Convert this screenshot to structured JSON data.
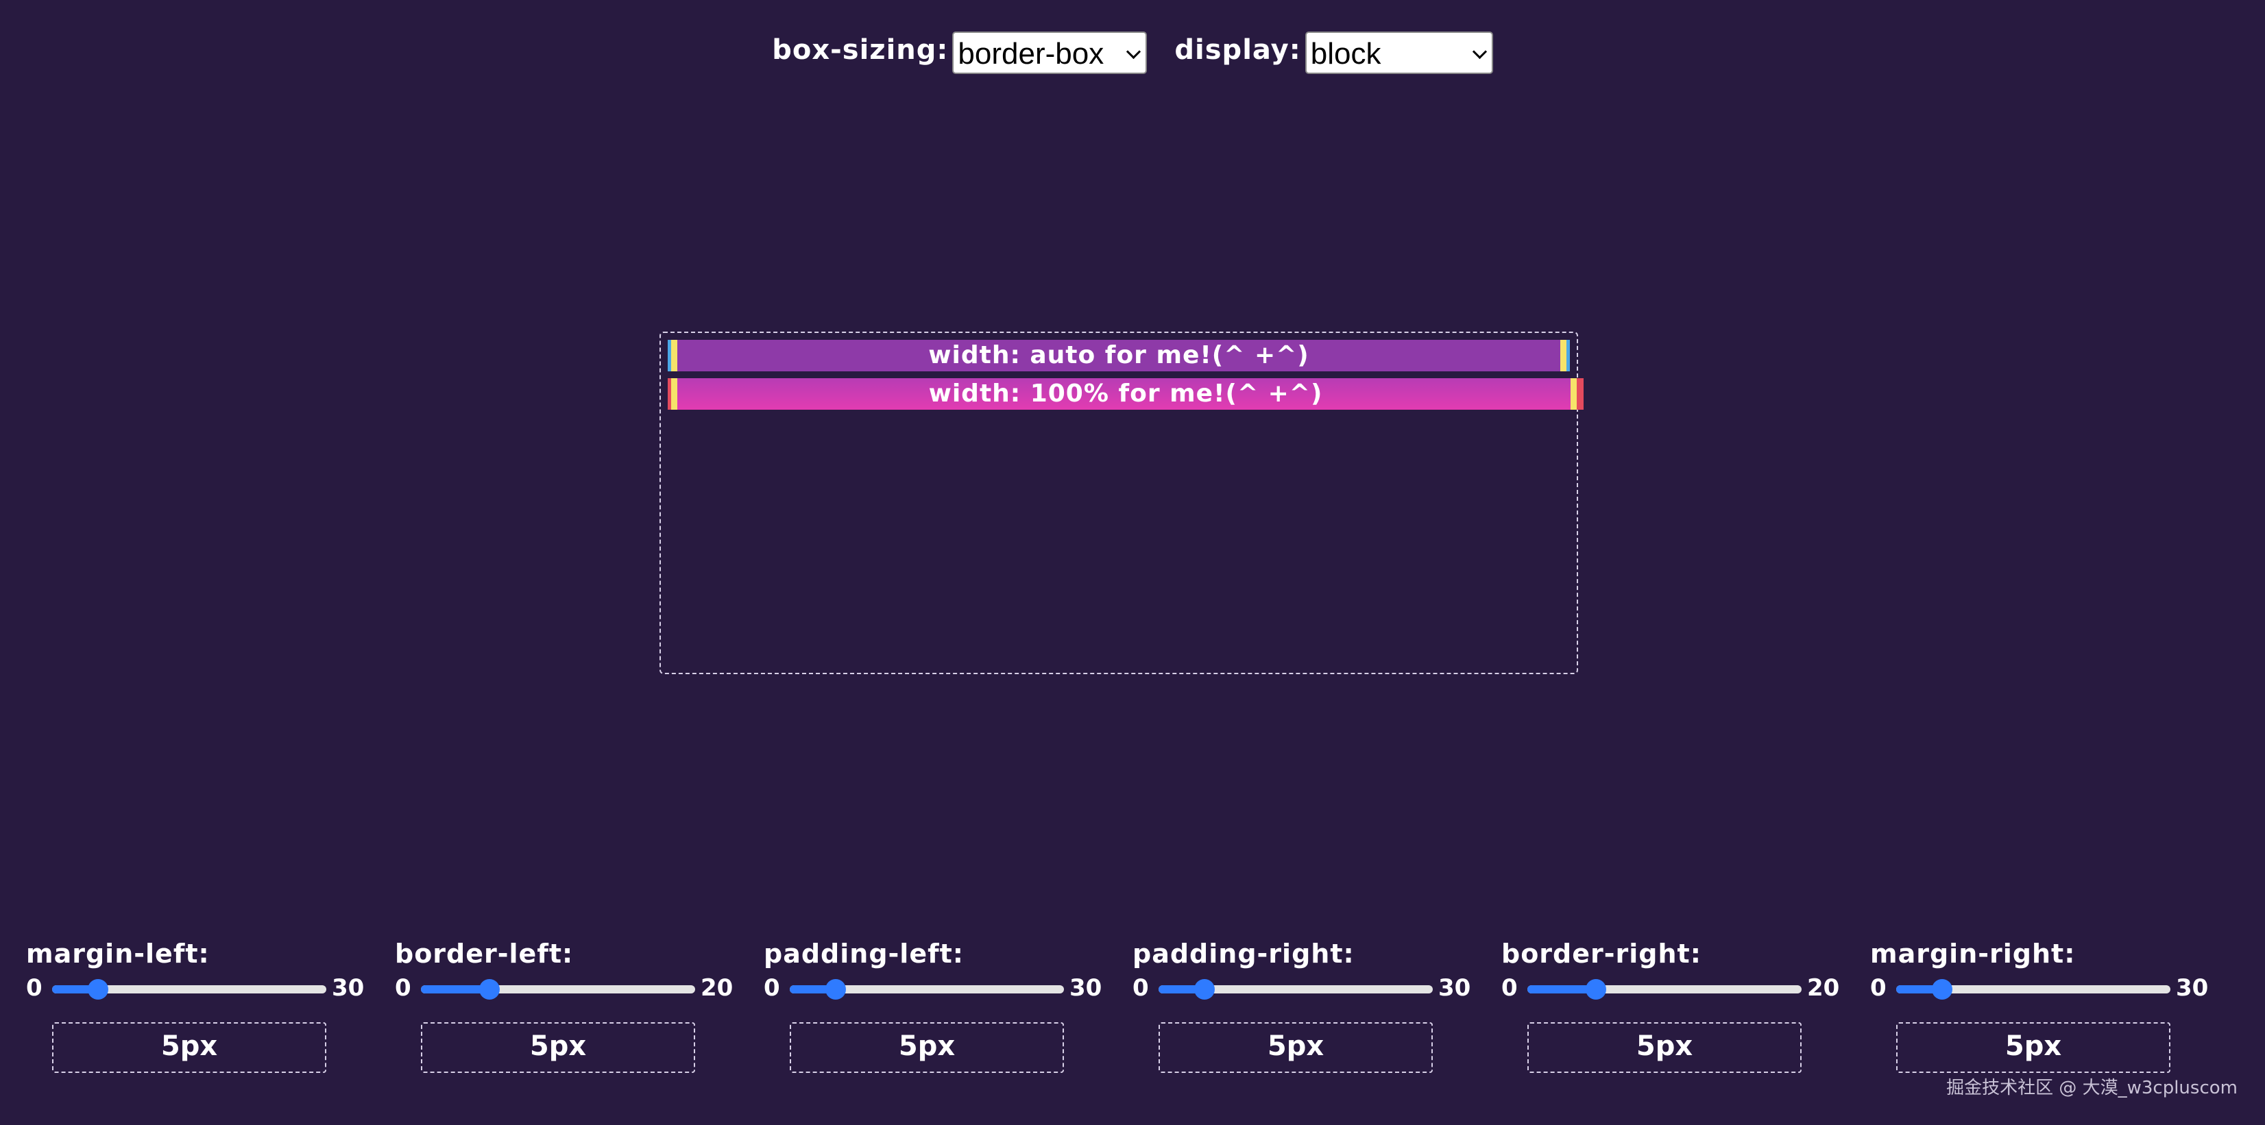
{
  "top_controls": {
    "box_sizing_label": "box-sizing:",
    "box_sizing_value": "border-box",
    "display_label": "display:",
    "display_value": "block"
  },
  "demo": {
    "auto_bar_text": "width: auto for me!(^ +^)",
    "full_bar_text": "width: 100% for me!(^ +^)"
  },
  "sliders": [
    {
      "label": "margin-left:",
      "min": "0",
      "max": "30",
      "value": 5,
      "value_text": "5px"
    },
    {
      "label": "border-left:",
      "min": "0",
      "max": "20",
      "value": 5,
      "value_text": "5px"
    },
    {
      "label": "padding-left:",
      "min": "0",
      "max": "30",
      "value": 5,
      "value_text": "5px"
    },
    {
      "label": "padding-right:",
      "min": "0",
      "max": "30",
      "value": 5,
      "value_text": "5px"
    },
    {
      "label": "border-right:",
      "min": "0",
      "max": "20",
      "value": 5,
      "value_text": "5px"
    },
    {
      "label": "margin-right:",
      "min": "0",
      "max": "30",
      "value": 5,
      "value_text": "5px"
    }
  ],
  "colors": {
    "background": "#281a40",
    "auto_bar": "#8e3aa8",
    "full_bar": "#e23cb2",
    "slider_accent": "#2f7bff",
    "edge_blue": "#4aa8e8",
    "edge_yellow": "#f6e36a",
    "edge_red": "#e44a5e"
  },
  "watermark": "掘金技术社区 @ 大漠_w3cpluscom"
}
